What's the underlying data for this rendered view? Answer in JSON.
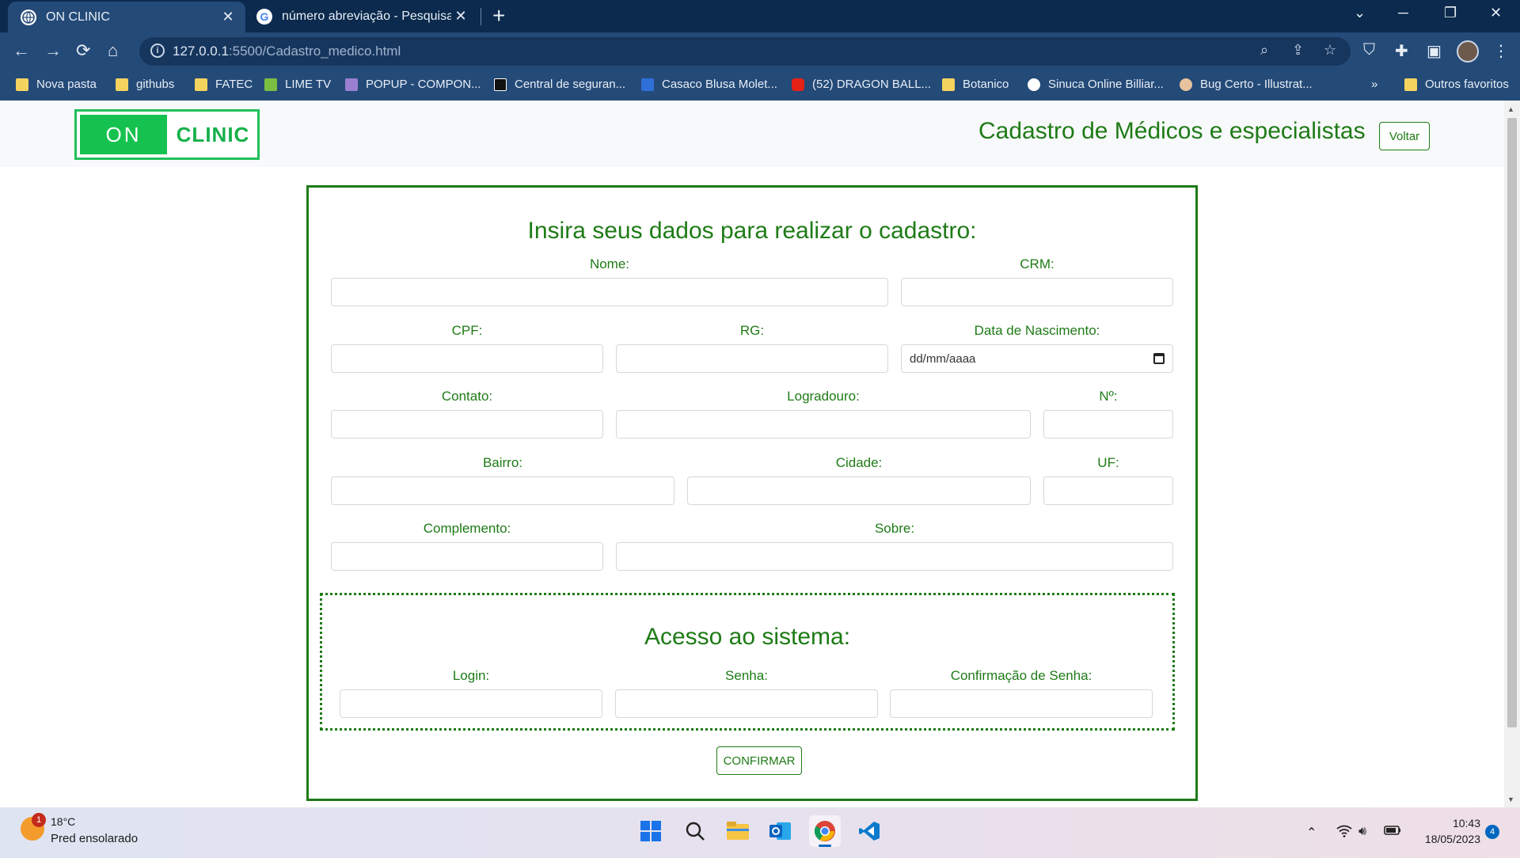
{
  "browser": {
    "tabs": [
      {
        "title": "ON CLINIC",
        "active": true
      },
      {
        "title": "número abreviação - Pesquisa Go",
        "active": false
      }
    ],
    "url_host": "127.0.0.1",
    "url_path": ":5500/Cadastro_medico.html",
    "bookmarks": [
      "Nova pasta",
      "githubs",
      "FATEC",
      "LIME TV",
      "POPUP - COMPON...",
      "Central de seguran...",
      "Casaco Blusa Molet...",
      "(52) DRAGON BALL...",
      "Botanico",
      "Sinuca Online Billiar...",
      "Bug Certo - Illustrat..."
    ],
    "bookmarks_more": "»",
    "other_bookmarks": "Outros favoritos"
  },
  "header": {
    "logo_on": "ON",
    "logo_clinic": "CLINIC",
    "title": "Cadastro de Médicos e especialistas",
    "back_label": "Voltar"
  },
  "form": {
    "title": "Insira seus dados para realizar o cadastro:",
    "fields": {
      "nome": "Nome:",
      "crm": "CRM:",
      "cpf": "CPF:",
      "rg": "RG:",
      "nascimento": "Data de Nascimento:",
      "nascimento_placeholder": "dd/mm/aaaa",
      "contato": "Contato:",
      "logradouro": "Logradouro:",
      "numero": "Nº:",
      "bairro": "Bairro:",
      "cidade": "Cidade:",
      "uf": "UF:",
      "complemento": "Complemento:",
      "sobre": "Sobre:"
    },
    "access": {
      "title": "Acesso ao sistema:",
      "login": "Login:",
      "senha": "Senha:",
      "confirmacao": "Confirmação de Senha:"
    },
    "confirm_label": "CONFIRMAR"
  },
  "taskbar": {
    "weather_badge": "1",
    "temperature": "18°C",
    "weather": "Pred ensolarado",
    "time": "10:43",
    "date": "18/05/2023",
    "notifications": "4"
  },
  "colors": {
    "brand_green": "#1e7b16",
    "logo_green": "#16c24f",
    "chrome_dark": "#0b2a4d",
    "chrome": "#244a78"
  }
}
